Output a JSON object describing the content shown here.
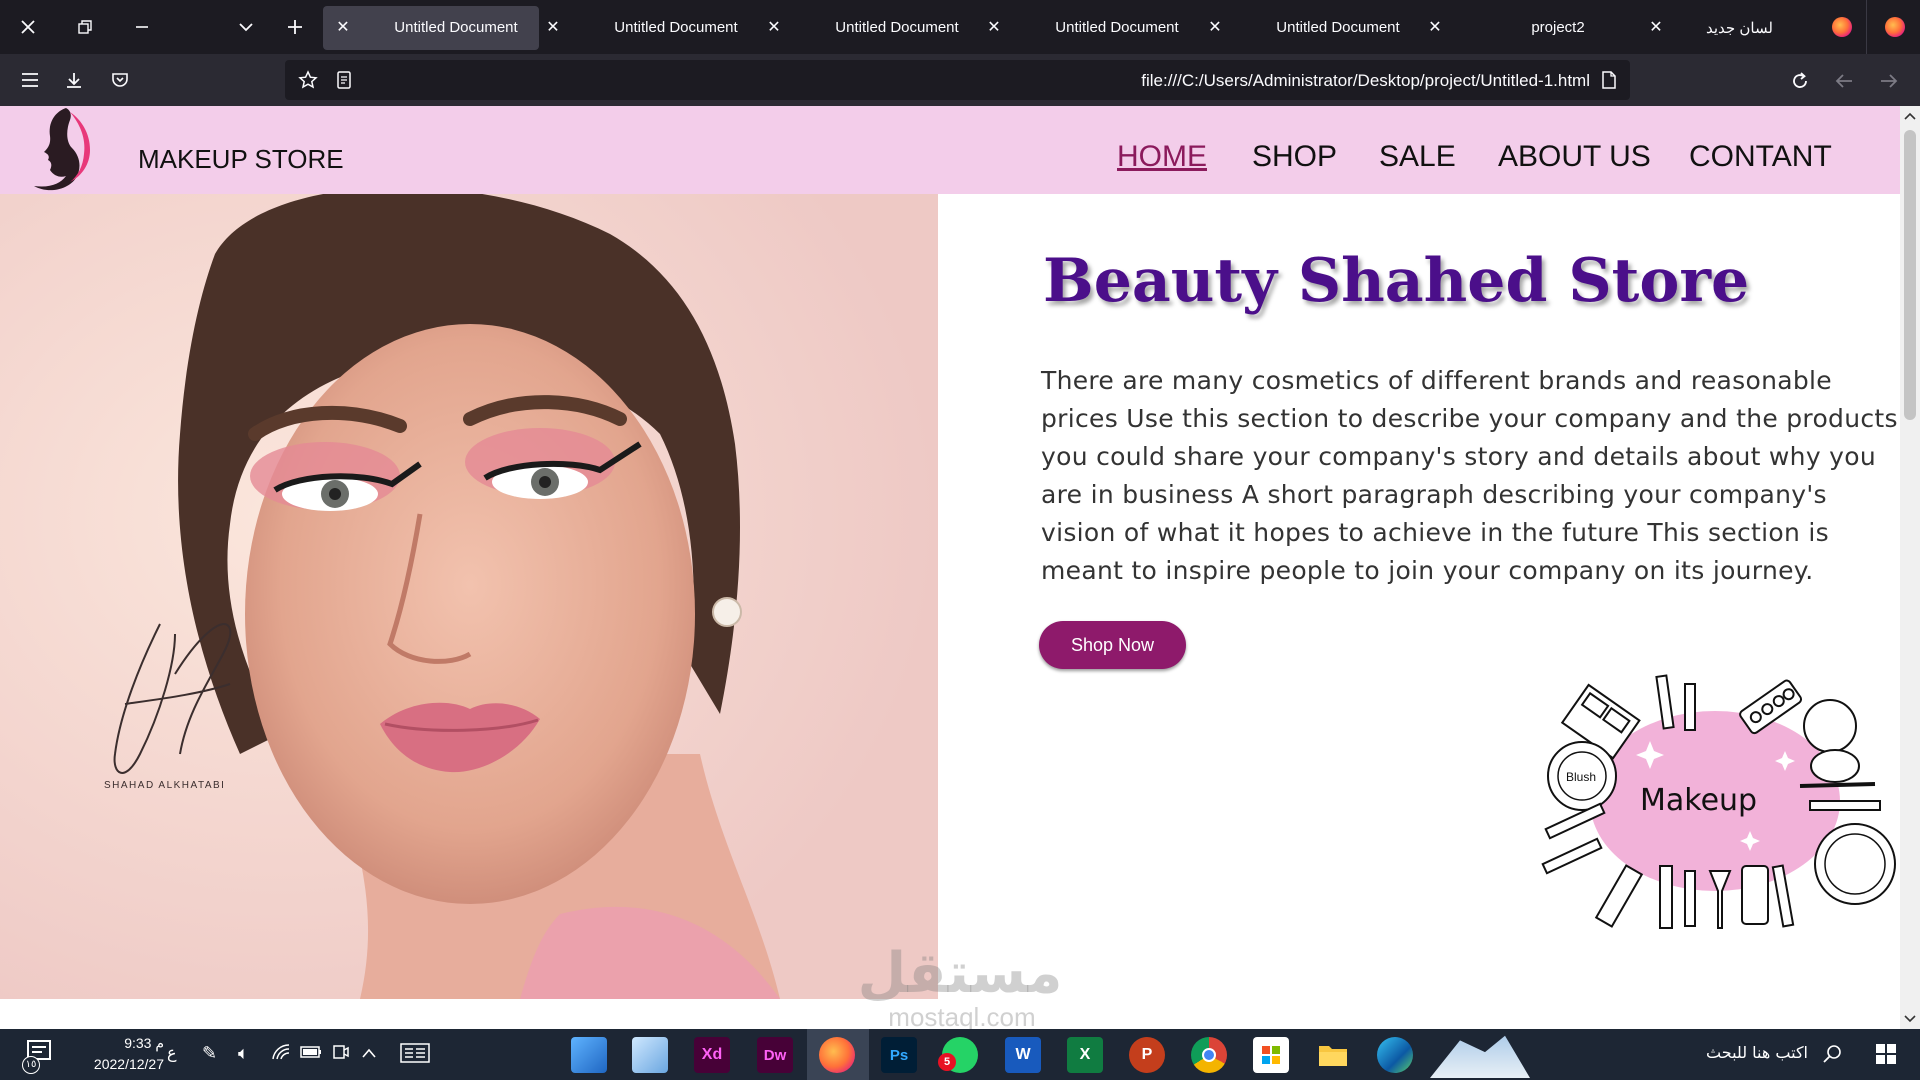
{
  "browser": {
    "tabs": [
      {
        "label": "Untitled Document",
        "active": true
      },
      {
        "label": "Untitled Document",
        "active": false
      },
      {
        "label": "Untitled Document",
        "active": false
      },
      {
        "label": "Untitled Document",
        "active": false
      },
      {
        "label": "Untitled Document",
        "active": false
      },
      {
        "label": "project2",
        "active": false
      },
      {
        "label": "لسان جديد",
        "active": false
      }
    ],
    "url": "file:///C:/Users/Administrator/Desktop/project/Untitled-1.html",
    "icons": {
      "close_window": "close-icon",
      "restore": "restore-icon",
      "minimize": "minimize-icon",
      "tab_list": "chevron-down-icon",
      "new_tab": "plus-icon",
      "menu": "hamburger-icon",
      "downloads": "download-icon",
      "pocket": "pocket-icon",
      "bookmark": "star-icon",
      "reader": "reader-icon",
      "page": "page-icon",
      "reload": "reload-icon",
      "back": "arrow-left-icon",
      "forward": "arrow-right-icon"
    }
  },
  "site": {
    "brand": "MAKEUP STORE",
    "nav": [
      {
        "label": "HOME",
        "active": true
      },
      {
        "label": "SHOP",
        "active": false
      },
      {
        "label": "SALE",
        "active": false
      },
      {
        "label": "ABOUT US",
        "active": false
      },
      {
        "label": "CONTANT",
        "active": false
      }
    ],
    "hero_signature": "SHAHAD ALKHATABI",
    "title": "Beauty Shahed Store",
    "paragraph": "There are many cosmetics of different brands and reasonable prices Use this section to describe your company and the products you could share your company's story and details about why you are in business A short paragraph describing your company's vision of what it hopes to achieve in the future This section is meant to inspire people to join your company on its journey.",
    "button": "Shop Now",
    "makeup_badge": "Makeup",
    "blush_label": "Blush",
    "watermark": "مستقل",
    "watermark_sub": "mostaql.com",
    "colors": {
      "header_bg": "#f3cdea",
      "active_nav": "#8b1a5c",
      "title": "#4b0f8a",
      "button_bg": "#8e1a6b"
    }
  },
  "taskbar": {
    "time": "9:33 م",
    "date": "2022/12/27",
    "lang": "ع",
    "search_placeholder": "اكتب هنا للبحث",
    "notif_count": "١٥",
    "whatsapp_badge": "5",
    "apps": [
      "photos-icon",
      "paint-icon",
      "xd-icon",
      "dreamweaver-icon",
      "firefox-icon",
      "photoshop-icon",
      "whatsapp-icon",
      "word-icon",
      "excel-icon",
      "powerpoint-icon",
      "chrome-icon",
      "store-icon",
      "file-explorer-icon",
      "edge-icon"
    ],
    "app_labels": {
      "xd": "Xd",
      "dw": "Dw",
      "ps": "Ps",
      "word": "W",
      "excel": "X",
      "ppt": "P"
    }
  }
}
